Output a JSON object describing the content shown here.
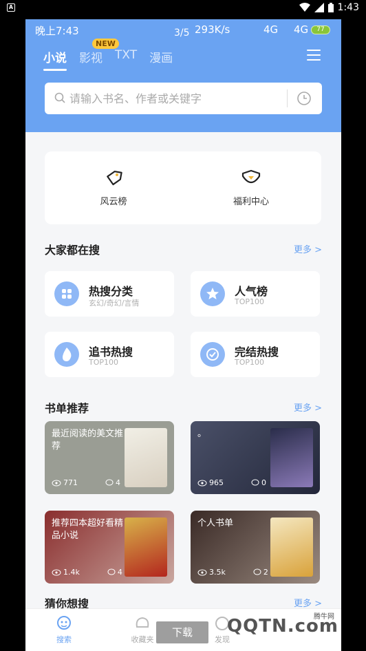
{
  "outer_status": {
    "time": "1:43"
  },
  "inner_status": {
    "time": "晚上7:43",
    "page": "3/5",
    "speed": "293K/s",
    "network1": "4G",
    "network2": "4G",
    "battery": "77"
  },
  "tabs": [
    {
      "label": "小说",
      "active": true
    },
    {
      "label": "影视",
      "active": false
    },
    {
      "label": "TXT",
      "active": false
    },
    {
      "label": "漫画",
      "active": false
    }
  ],
  "new_badge": "NEW",
  "search": {
    "placeholder": "请输入书名、作者或关键字"
  },
  "rank": [
    {
      "label": "风云榜",
      "icon": "tag-icon"
    },
    {
      "label": "福利中心",
      "icon": "gift-icon"
    }
  ],
  "popular": {
    "title": "大家都在搜",
    "more": "更多 >",
    "cards": [
      {
        "title": "热搜分类",
        "sub": "玄幻/奇幻/言情",
        "icon": "grid-icon"
      },
      {
        "title": "人气榜",
        "sub": "TOP100",
        "icon": "star-icon"
      },
      {
        "title": "追书热搜",
        "sub": "TOP100",
        "icon": "flame-icon"
      },
      {
        "title": "完结热搜",
        "sub": "TOP100",
        "icon": "check-icon"
      }
    ]
  },
  "booklist": {
    "title": "书单推荐",
    "more": "更多 >",
    "cards": [
      {
        "title": "最近阅读的美文推荐",
        "views": "771",
        "comments": "4",
        "bg": "#9a9d94"
      },
      {
        "title": "。",
        "views": "965",
        "comments": "0",
        "bg": "#3a3f55"
      },
      {
        "title": "推荐四本超好看精品小说",
        "views": "1.4k",
        "comments": "4",
        "bg": "#7a2a2a"
      },
      {
        "title": "个人书单",
        "views": "3.5k",
        "comments": "2",
        "bg": "#4a3a36"
      }
    ]
  },
  "guess": {
    "title": "猜你想搜",
    "more": "更多 >"
  },
  "bottom_nav": [
    {
      "label": "搜索",
      "active": true
    },
    {
      "label": "收藏夹",
      "active": false
    },
    {
      "label": "发现",
      "active": false
    }
  ],
  "download_label": "下载",
  "watermark": {
    "main": "QQTN.com",
    "small": "腾牛网"
  },
  "colors": {
    "accent": "#6aa3f2",
    "badge": "#ffc83c"
  }
}
